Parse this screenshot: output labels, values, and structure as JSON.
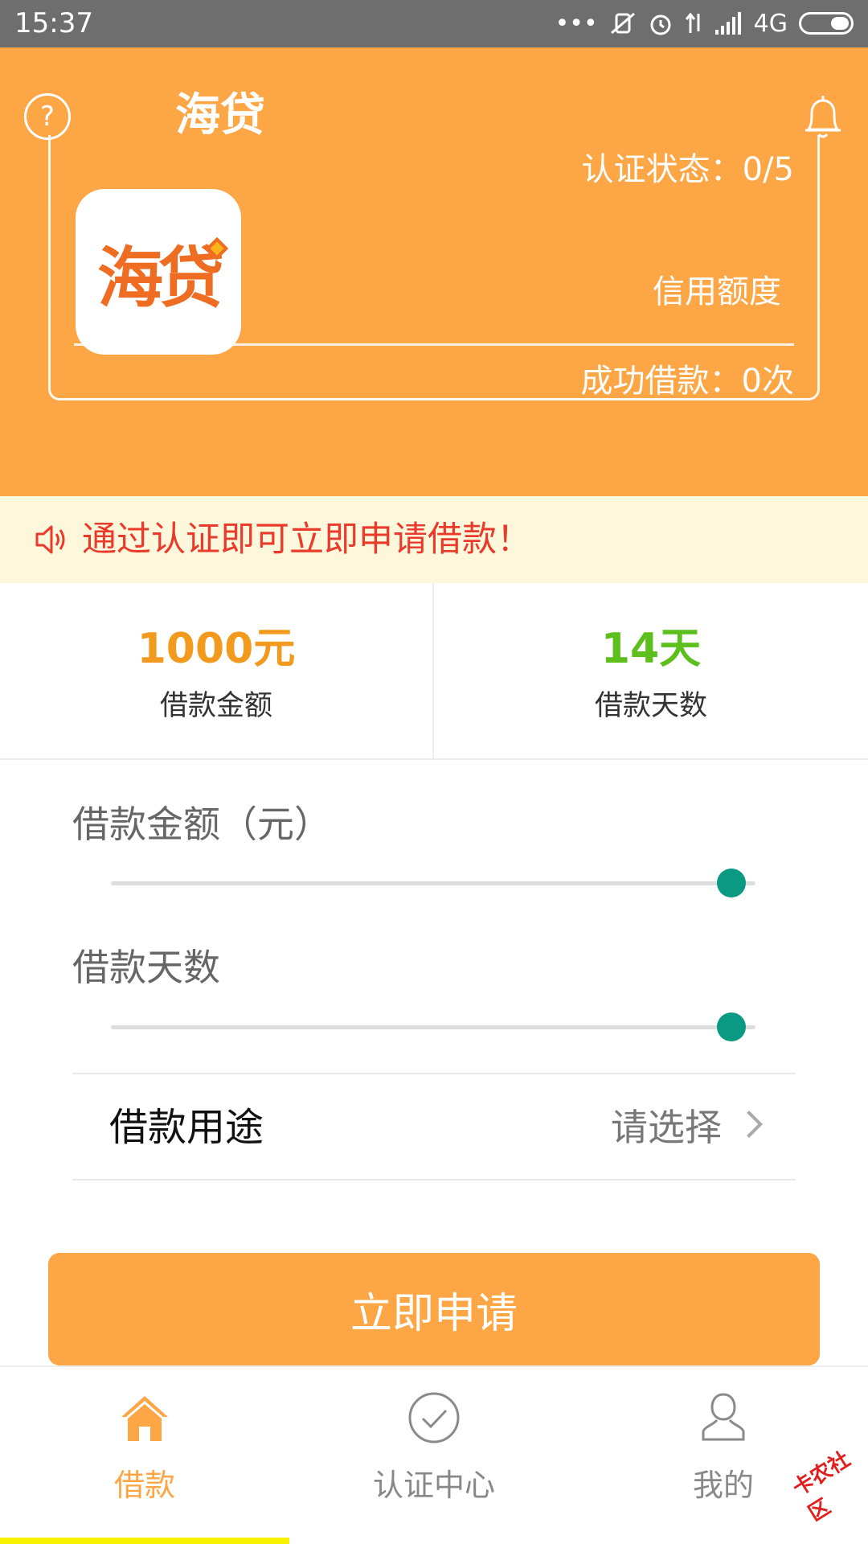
{
  "status_bar": {
    "time": "15:37",
    "dots": "•••",
    "network": "4G"
  },
  "header": {
    "title": "海贷",
    "help_glyph": "?"
  },
  "card": {
    "logo_text": "海贷",
    "cert_status": "认证状态：0/5",
    "credit_label": "信用额度",
    "loan_count": "成功借款：0次"
  },
  "notice": {
    "text": "通过认证即可立即申请借款！"
  },
  "stats": {
    "amount_value": "1000元",
    "amount_label": "借款金额",
    "days_value": "14天",
    "days_label": "借款天数"
  },
  "form": {
    "amount_label": "借款金额（元）",
    "amount_slider_level": 1.0,
    "days_label": "借款天数",
    "days_slider_level": 1.0,
    "purpose_label": "借款用途",
    "purpose_value": "请选择"
  },
  "apply_button": {
    "label": "立即申请"
  },
  "tabs": [
    {
      "label": "借款",
      "icon": "home-icon",
      "active": true
    },
    {
      "label": "认证中心",
      "icon": "check-circle-icon",
      "active": false
    },
    {
      "label": "我的",
      "icon": "user-icon",
      "active": false
    }
  ],
  "watermark": "卡农社区",
  "colors": {
    "accent": "#fca645",
    "status_bar": "#6e6e6e",
    "notice_bg": "#fdf8dc",
    "notice_text": "#ea3a2c",
    "amount": "#f29a1d",
    "days": "#5cbf1b",
    "slider": "#0a9a83",
    "tab_inactive": "#888888"
  }
}
